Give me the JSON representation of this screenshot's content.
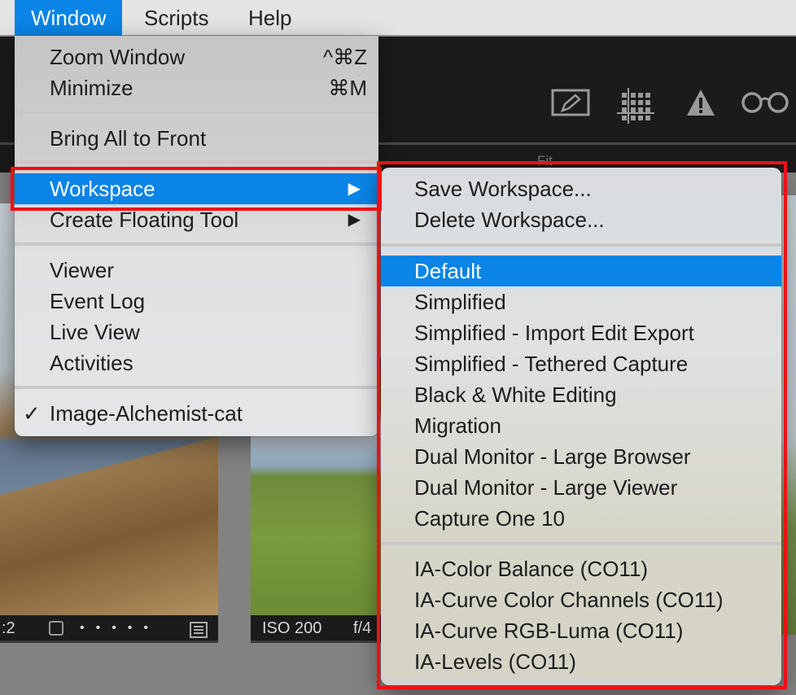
{
  "menubar": {
    "items": [
      {
        "label": "Window",
        "active": true
      },
      {
        "label": "Scripts",
        "active": false
      },
      {
        "label": "Help",
        "active": false
      }
    ]
  },
  "toolbar": {
    "icons": [
      "edit-icon",
      "grid-icon",
      "warning-icon",
      "glasses-icon"
    ],
    "fit_label": "Fit"
  },
  "window_menu": {
    "items": [
      {
        "label": "Zoom Window",
        "shortcut": "^⌘Z"
      },
      {
        "label": "Minimize",
        "shortcut": "⌘M"
      },
      {
        "label": "Bring All to Front"
      },
      {
        "label": "Workspace",
        "submenu": true,
        "highlighted": true
      },
      {
        "label": "Create Floating Tool",
        "submenu": true
      },
      {
        "label": "Viewer"
      },
      {
        "label": "Event Log"
      },
      {
        "label": "Live View"
      },
      {
        "label": "Activities"
      },
      {
        "label": "Image-Alchemist-cat",
        "checked": true
      }
    ],
    "arrow_glyph": "▶",
    "check_glyph": "✓"
  },
  "workspace_submenu": {
    "actions": [
      "Save Workspace...",
      "Delete Workspace..."
    ],
    "workspaces": [
      {
        "label": "Default",
        "highlighted": true
      },
      {
        "label": "Simplified"
      },
      {
        "label": "Simplified - Import Edit Export"
      },
      {
        "label": "Simplified - Tethered Capture"
      },
      {
        "label": "Black & White Editing"
      },
      {
        "label": "Migration"
      },
      {
        "label": "Dual Monitor - Large Browser"
      },
      {
        "label": "Dual Monitor - Large Viewer"
      },
      {
        "label": "Capture One 10"
      }
    ],
    "custom": [
      "IA-Color Balance (CO11)",
      "IA-Curve Color Channels (CO11)",
      "IA-Curve RGB-Luma (CO11)",
      "IA-Levels (CO11)"
    ]
  },
  "thumbnails": [
    {
      "caption_left": ":2",
      "rating_dots": 5
    },
    {
      "caption_left": "ISO 200",
      "caption_right": "f/4"
    }
  ],
  "colors": {
    "highlight": "#0a84e6",
    "annotation": "#ee1111"
  }
}
